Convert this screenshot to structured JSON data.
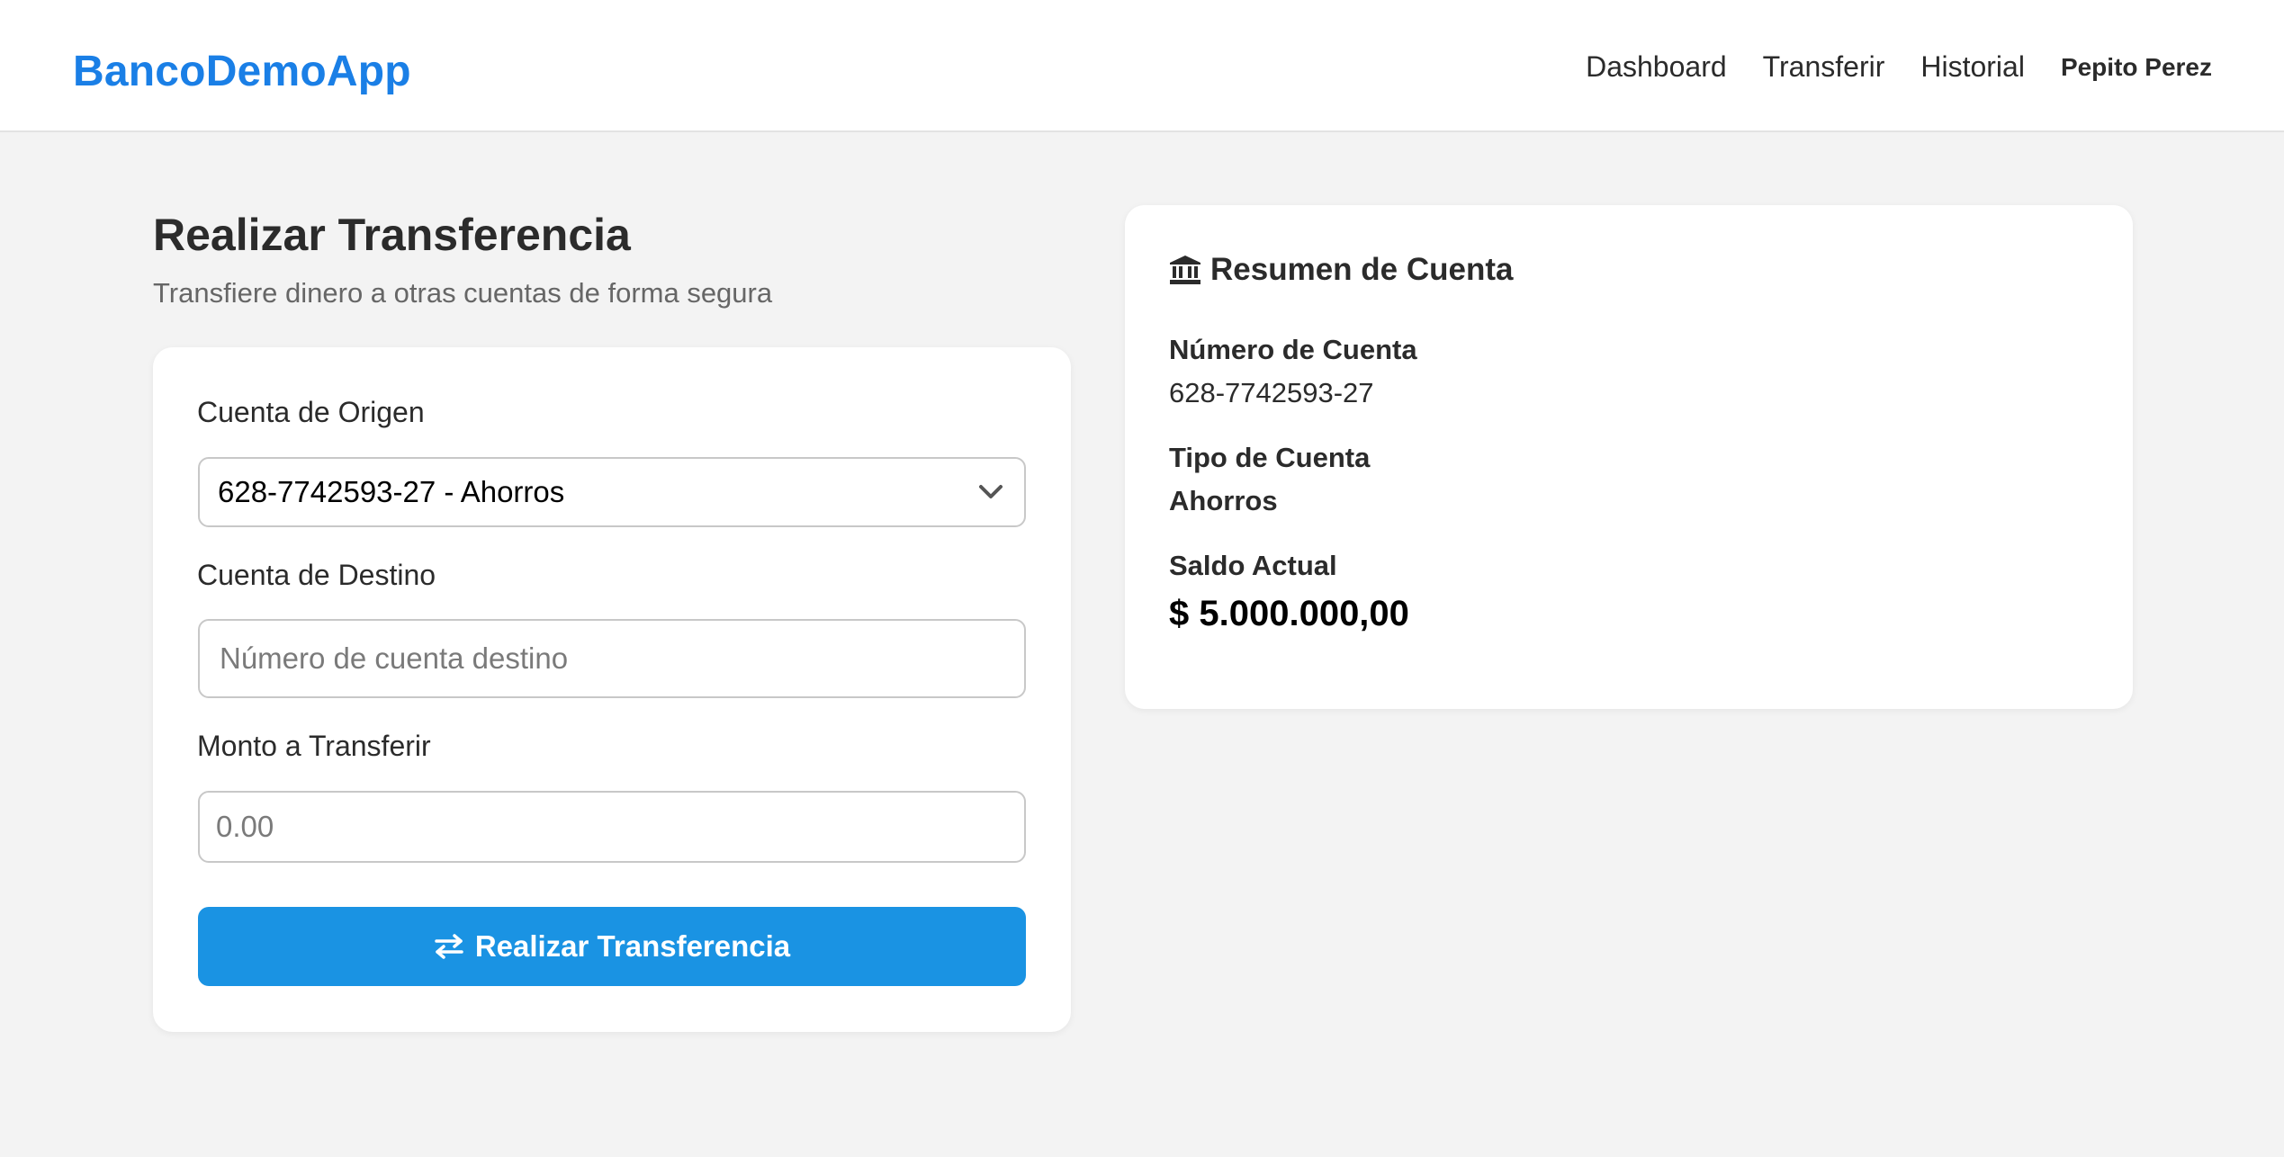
{
  "header": {
    "brand": "BancoDemoApp",
    "nav": [
      "Dashboard",
      "Transferir",
      "Historial"
    ],
    "user_name": "Pepito Perez",
    "brand_color": "#1a7fe6"
  },
  "transfer": {
    "title": "Realizar Transferencia",
    "subtitle": "Transfiere dinero a otras cuentas de forma segura",
    "origin_label": "Cuenta de Origen",
    "origin_selected": "628-7742593-27 - Ahorros",
    "dest_label": "Cuenta de Destino",
    "dest_placeholder": "Número de cuenta destino",
    "dest_value": "",
    "amount_label": "Monto a Transferir",
    "amount_placeholder": "0.00",
    "amount_value": "",
    "submit_label": "Realizar Transferencia",
    "submit_icon": "exchange-arrows-icon",
    "button_color": "#1a93e3"
  },
  "summary": {
    "title": "Resumen de Cuenta",
    "title_icon": "bank-icon",
    "account_number_label": "Número de Cuenta",
    "account_number": "628-7742593-27",
    "account_type_label": "Tipo de Cuenta",
    "account_type": "Ahorros",
    "balance_label": "Saldo Actual",
    "balance": "$ 5.000.000,00"
  }
}
